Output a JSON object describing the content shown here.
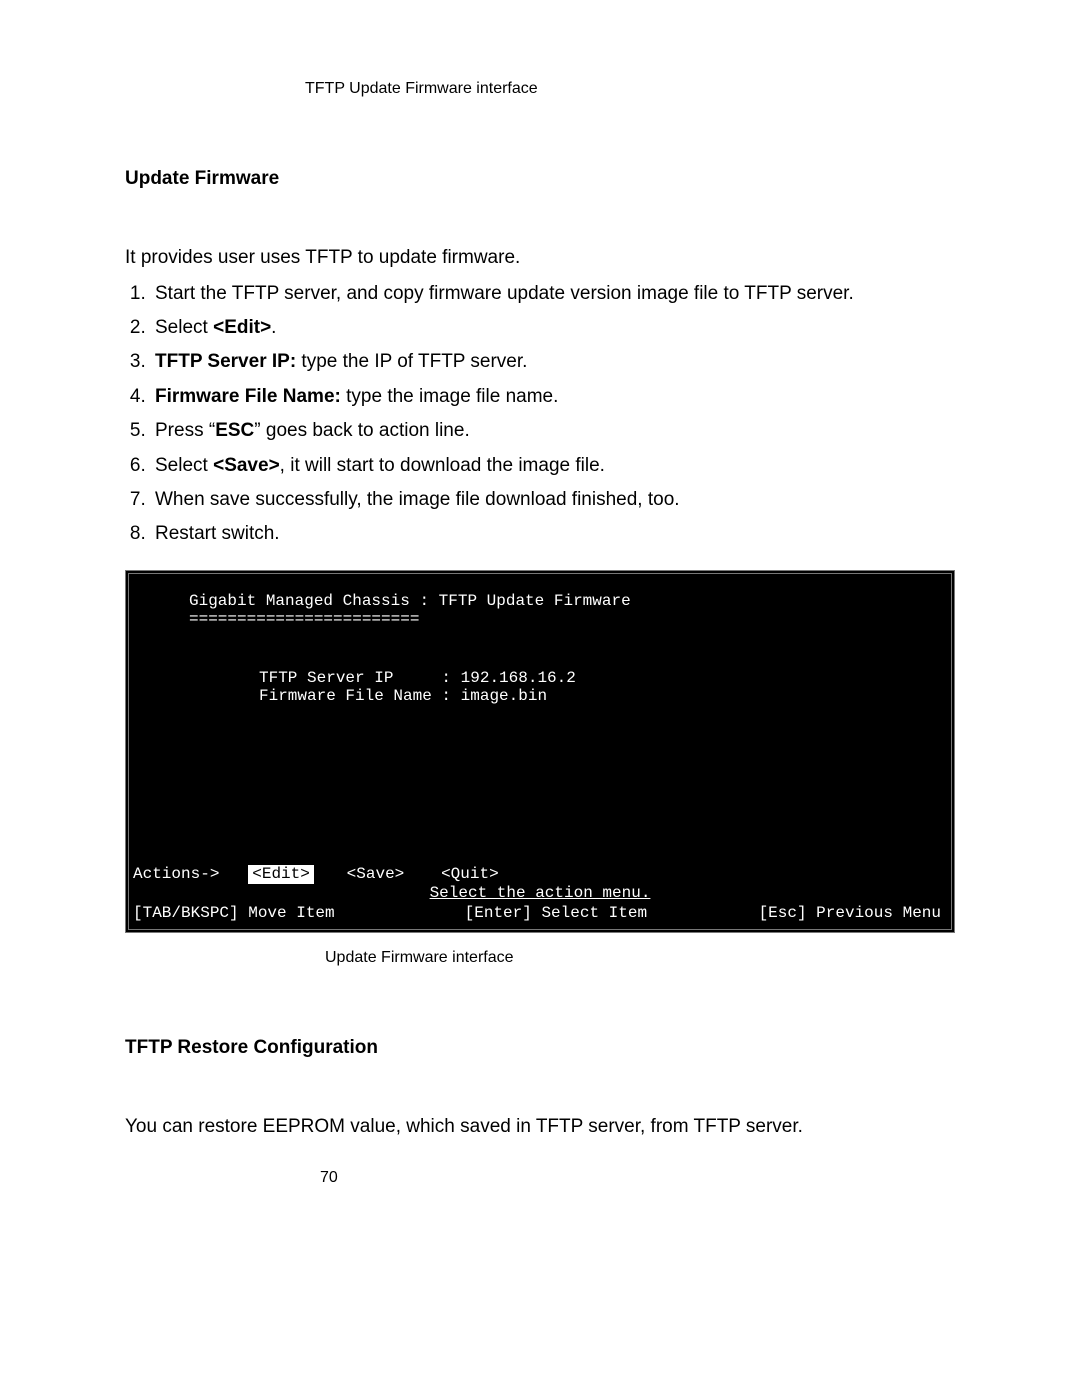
{
  "top_caption": "TFTP Update Firmware interface",
  "heading1": "Update Firmware",
  "intro_para": "It provides user uses TFTP to update firmware.",
  "steps": {
    "s1": "Start the TFTP server, and copy firmware update version image file to TFTP server.",
    "s2_pre": "Select ",
    "s2_bold": "<Edit>",
    "s2_post": ".",
    "s3_bold": "TFTP Server IP:",
    "s3_post": " type the IP of TFTP server.",
    "s4_bold": "Firmware File Name:",
    "s4_post": " type the image file name.",
    "s5_pre": "Press “",
    "s5_bold": "ESC",
    "s5_post": "” goes back to action line.",
    "s6_pre": "Select ",
    "s6_bold": "<Save>",
    "s6_post": ", it will start to download the image file.",
    "s7": "When save successfully, the image file download finished, too.",
    "s8": "Restart switch."
  },
  "terminal": {
    "title": "Gigabit Managed Chassis : TFTP Update Firmware",
    "separator": "========================",
    "field_ip_label": "TFTP Server IP     : ",
    "field_ip_value": "192.168.16.2",
    "field_file_label": "Firmware File Name : ",
    "field_file_value": "image.bin",
    "actions_label": "Actions->",
    "action_edit": "<Edit>",
    "action_save": "<Save>",
    "action_quit": "<Quit>",
    "select_line": "Select the action menu.",
    "help_move": "[TAB/BKSPC] Move Item",
    "help_select": "[Enter] Select Item",
    "help_prev": "[Esc] Previous Menu"
  },
  "mid_caption": "Update Firmware interface",
  "heading2": "TFTP Restore Configuration",
  "restore_para": "You can restore EEPROM value, which saved in TFTP server, from TFTP server.",
  "page_number": "70"
}
